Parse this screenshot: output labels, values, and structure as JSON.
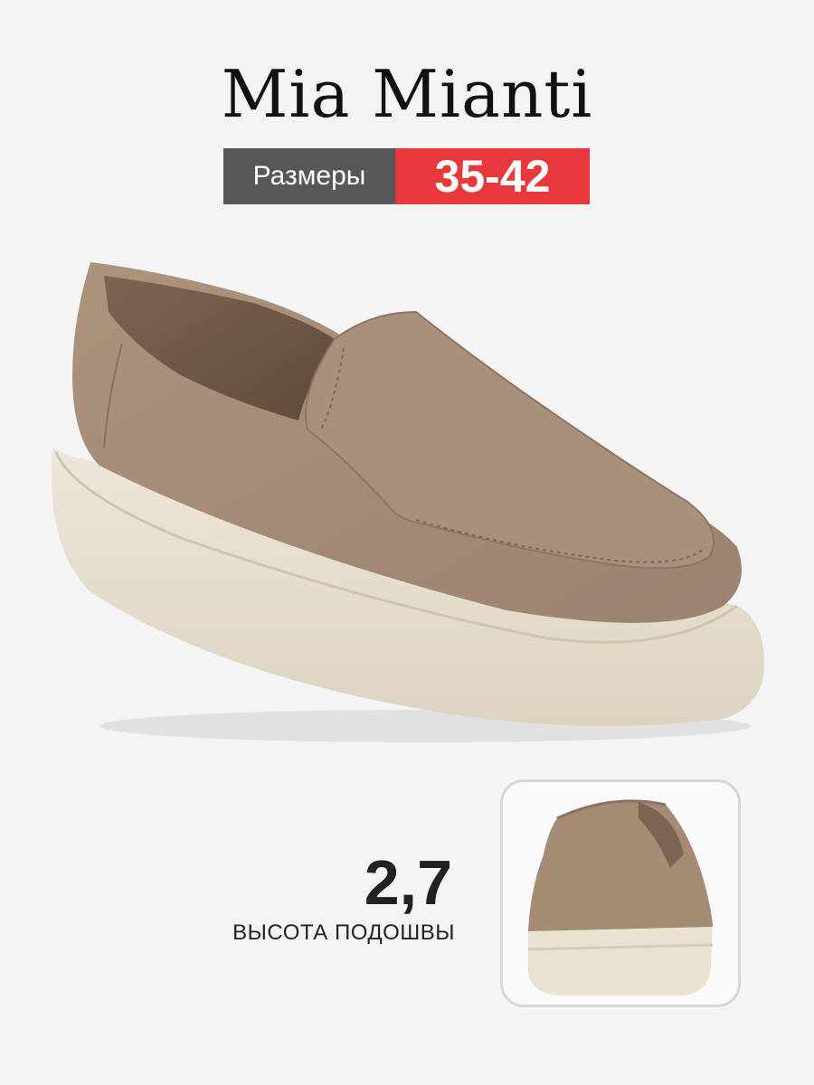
{
  "brand": "Mia Mianti",
  "size_badge": {
    "label": "Размеры",
    "value": "35-42",
    "label_color": "#575757",
    "value_color": "#e8383c"
  },
  "sole": {
    "height_value": "2,7",
    "caption": "ВЫСОТА ПОДОШВЫ"
  },
  "product": {
    "upper_color": "#a58a74",
    "sole_color": "#e9e1d2"
  }
}
